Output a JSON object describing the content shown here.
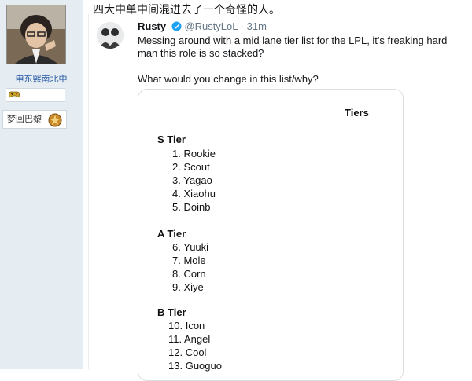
{
  "sidebar": {
    "user_name": "申东熙南北中",
    "badge_icon": "gamepad-icon",
    "medal_label": "梦回巴黎",
    "medal_icon": "medal-icon"
  },
  "post": {
    "text": "四大中单中间混进去了一个奇怪的人。"
  },
  "tweet": {
    "name": "Rusty",
    "handle": "@RustyLoL",
    "separator": "·",
    "time": "31m",
    "body": "Messing around with a mid lane tier list for the LPL, it's freaking hard man this role is so stacked?",
    "question": "What would you change in this list/why?",
    "card": {
      "title": "Tiers",
      "tiers": [
        {
          "heading": "S Tier",
          "items": [
            {
              "num": "1.",
              "name": "Rookie"
            },
            {
              "num": "2.",
              "name": "Scout"
            },
            {
              "num": "3.",
              "name": "Yagao"
            },
            {
              "num": "4.",
              "name": "Xiaohu"
            },
            {
              "num": "5.",
              "name": "Doinb"
            }
          ]
        },
        {
          "heading": "A Tier",
          "items": [
            {
              "num": "6.",
              "name": "Yuuki"
            },
            {
              "num": "7.",
              "name": "Mole"
            },
            {
              "num": "8.",
              "name": "Corn"
            },
            {
              "num": "9.",
              "name": "Xiye"
            }
          ]
        },
        {
          "heading": "B Tier",
          "items": [
            {
              "num": "10.",
              "name": "Icon"
            },
            {
              "num": "11.",
              "name": "Angel"
            },
            {
              "num": "12.",
              "name": "Cool"
            },
            {
              "num": "13.",
              "name": "Guoguo"
            }
          ]
        }
      ]
    }
  },
  "colors": {
    "sidebar_bg": "#e5edf2",
    "link": "#2255a4",
    "verified": "#1da1f2",
    "muted": "#657786"
  }
}
